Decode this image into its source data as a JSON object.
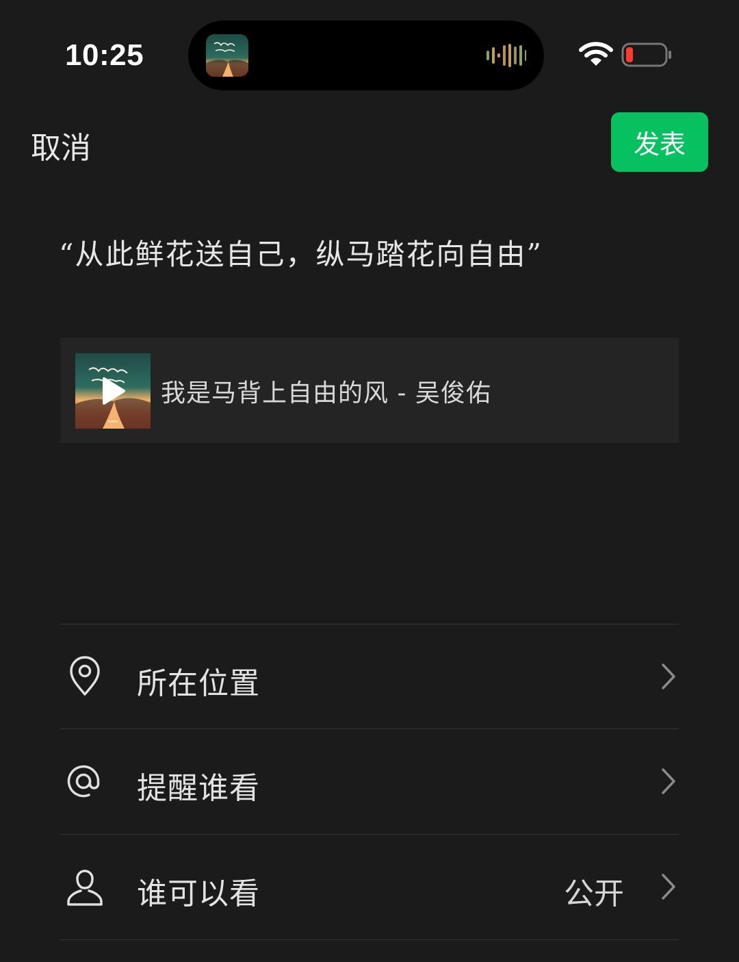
{
  "status_bar": {
    "time": "10:25"
  },
  "nav": {
    "cancel_label": "取消",
    "publish_label": "发表"
  },
  "post": {
    "text": "“从此鲜花送自己，纵马踏花向自由”"
  },
  "music": {
    "title": "我是马背上自由的风 - 吴俊佑"
  },
  "menu": {
    "items": [
      {
        "label": "所在位置",
        "icon": "location-pin-icon"
      },
      {
        "label": "提醒谁看",
        "icon": "at-sign-icon"
      },
      {
        "label": "谁可以看",
        "icon": "person-icon",
        "value": "公开"
      }
    ]
  },
  "colors": {
    "background": "#1b1b1b",
    "accent": "#07c160",
    "card": "#242424"
  }
}
